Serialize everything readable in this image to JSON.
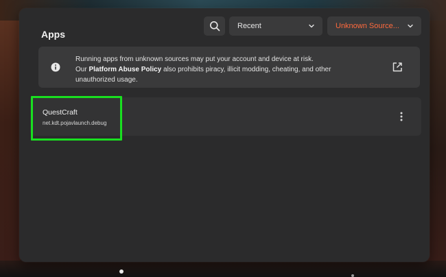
{
  "header": {
    "title": "Apps",
    "sort_dropdown": {
      "selected": "Recent"
    },
    "source_dropdown": {
      "selected": "Unknown Source...",
      "color": "#ff6a3d"
    }
  },
  "icons": {
    "search": "search-icon",
    "chevron": "chevron-down-icon",
    "info": "info-icon",
    "external_link": "external-link-icon",
    "more": "more-vertical-icon"
  },
  "warning": {
    "line1": "Running apps from unknown sources may put your account and device at risk.",
    "line2_prefix": "Our ",
    "policy_link": "Platform Abuse Policy",
    "line2_suffix": " also prohibits piracy, illicit modding, cheating, and other",
    "line3": "unauthorized usage."
  },
  "apps": [
    {
      "name": "QuestCraft",
      "package": "net.kdt.pojavlaunch.debug"
    }
  ],
  "colors": {
    "panel": "#2b2b2c",
    "card": "#3a3a3b",
    "highlight": "#19e020"
  }
}
